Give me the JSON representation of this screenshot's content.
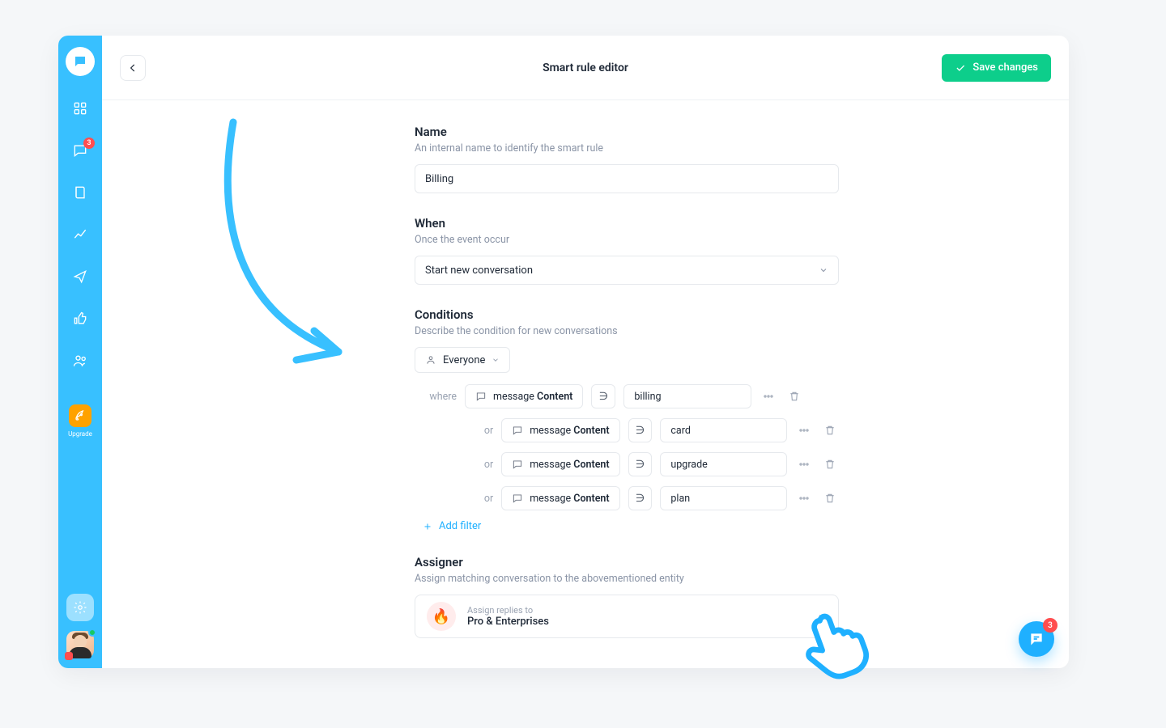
{
  "header": {
    "title": "Smart rule editor",
    "save_label": "Save changes"
  },
  "sidebar": {
    "upgrade_label": "Upgrade",
    "inbox_badge": "3"
  },
  "sections": {
    "name": {
      "title": "Name",
      "desc": "An internal name to identify the smart rule",
      "value": "Billing"
    },
    "when": {
      "title": "When",
      "desc": "Once the event occur",
      "value": "Start new conversation"
    },
    "conditions": {
      "title": "Conditions",
      "desc": "Describe the condition for new conversations",
      "audience": "Everyone",
      "joiner_where": "where",
      "joiner_or": "or",
      "field_prefix": "message ",
      "field_bold": "Content",
      "operator_symbol": "∋",
      "rows": [
        {
          "value": "billing"
        },
        {
          "value": "card"
        },
        {
          "value": "upgrade"
        },
        {
          "value": "plan"
        }
      ],
      "add_filter": "Add filter"
    },
    "assigner": {
      "title": "Assigner",
      "desc": "Assign matching conversation to the abovementioned entity",
      "small": "Assign replies to",
      "value": "Pro & Enterprises",
      "icon_emoji": "🔥"
    }
  },
  "fab_badge": "3"
}
